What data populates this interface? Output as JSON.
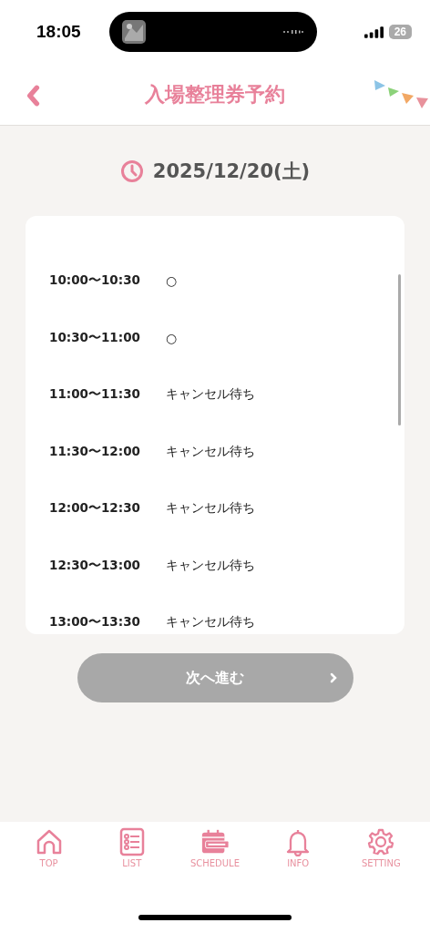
{
  "status_bar": {
    "time": "18:05",
    "battery": "26"
  },
  "header": {
    "title": "入場整理券予約"
  },
  "date": "2025/12/20(土)",
  "slots": [
    {
      "time": "10:00〜10:30",
      "status": "○"
    },
    {
      "time": "10:30〜11:00",
      "status": "○"
    },
    {
      "time": "11:00〜11:30",
      "status": "キャンセル待ち"
    },
    {
      "time": "11:30〜12:00",
      "status": "キャンセル待ち"
    },
    {
      "time": "12:00〜12:30",
      "status": "キャンセル待ち"
    },
    {
      "time": "12:30〜13:00",
      "status": "キャンセル待ち"
    },
    {
      "time": "13:00〜13:30",
      "status": "キャンセル待ち"
    }
  ],
  "next_button": {
    "label": "次へ進む",
    "disabled": true
  },
  "tabs": [
    {
      "label": "TOP",
      "kind": "home"
    },
    {
      "label": "LIST",
      "kind": "list"
    },
    {
      "label": "SCHEDULE",
      "kind": "schedule"
    },
    {
      "label": "INFO",
      "kind": "info"
    },
    {
      "label": "SETTING",
      "kind": "setting"
    }
  ]
}
